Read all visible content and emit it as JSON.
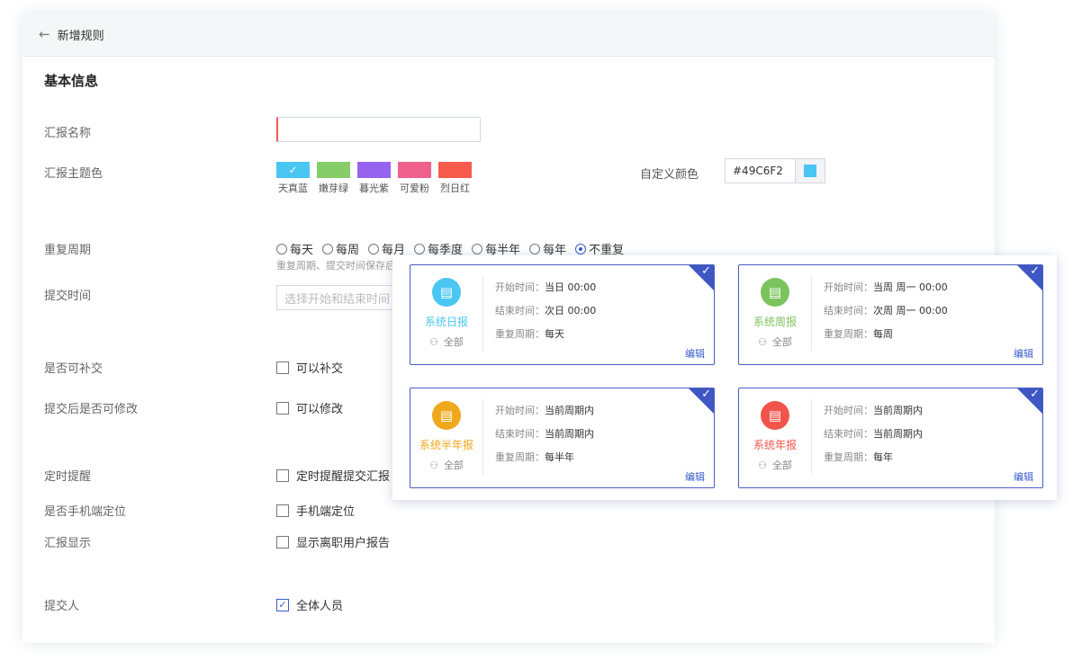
{
  "header": {
    "title": "新增规则"
  },
  "section_title": "基本信息",
  "labels": {
    "name": "汇报名称",
    "theme": "汇报主题色",
    "custom_color": "自定义颜色",
    "repeat": "重复周期",
    "submit_time": "提交时间",
    "late": "是否可补交",
    "modify": "提交后是否可修改",
    "remind": "定时提醒",
    "locate": "是否手机端定位",
    "display": "汇报显示",
    "submitter": "提交人"
  },
  "swatches": [
    {
      "label": "天真蓝",
      "color": "#49C6F2",
      "selected": true
    },
    {
      "label": "嫩芽绿",
      "color": "#86CC68"
    },
    {
      "label": "暮光紫",
      "color": "#9563EE"
    },
    {
      "label": "可爱粉",
      "color": "#F0608C"
    },
    {
      "label": "烈日红",
      "color": "#F55A4C"
    }
  ],
  "custom_color": {
    "value": "#49C6F2",
    "color": "#49C6F2"
  },
  "repeat_options": [
    "每天",
    "每周",
    "每月",
    "每季度",
    "每半年",
    "每年",
    "不重复"
  ],
  "repeat_selected": "不重复",
  "repeat_hint": "重复周期、提交时间保存后",
  "submit_time_placeholder": "选择开始和结束时间",
  "checkboxes": {
    "late": {
      "label": "可以补交",
      "checked": false
    },
    "modify": {
      "label": "可以修改",
      "checked": false
    },
    "remind": {
      "label": "定时提醒提交汇报",
      "checked": false
    },
    "locate": {
      "label": "手机端定位",
      "checked": false
    },
    "display": {
      "label": "显示离职用户报告",
      "checked": false
    },
    "submitter": {
      "label": "全体人员",
      "checked": true
    }
  },
  "cards": [
    {
      "name": "系统日报",
      "color": "#49C6F2",
      "scope": "全部",
      "start_k": "开始时间：",
      "start_v": "当日 00:00",
      "end_k": "结束时间：",
      "end_v": "次日 00:00",
      "repeat_k": "重复周期：",
      "repeat_v": "每天",
      "edit": "编辑"
    },
    {
      "name": "系统周报",
      "color": "#7CC35E",
      "scope": "全部",
      "start_k": "开始时间：",
      "start_v": "当周 周一 00:00",
      "end_k": "结束时间：",
      "end_v": "次周 周一 00:00",
      "repeat_k": "重复周期：",
      "repeat_v": "每周",
      "edit": "编辑"
    },
    {
      "name": "系统半年报",
      "color": "#F0A81C",
      "scope": "全部",
      "start_k": "开始时间：",
      "start_v": "当前周期内",
      "end_k": "结束时间：",
      "end_v": "当前周期内",
      "repeat_k": "重复周期：",
      "repeat_v": "每半年",
      "edit": "编辑"
    },
    {
      "name": "系统年报",
      "color": "#F0544A",
      "scope": "全部",
      "start_k": "开始时间：",
      "start_v": "当前周期内",
      "end_k": "结束时间：",
      "end_v": "当前周期内",
      "repeat_k": "重复周期：",
      "repeat_v": "每年",
      "edit": "编辑"
    }
  ]
}
